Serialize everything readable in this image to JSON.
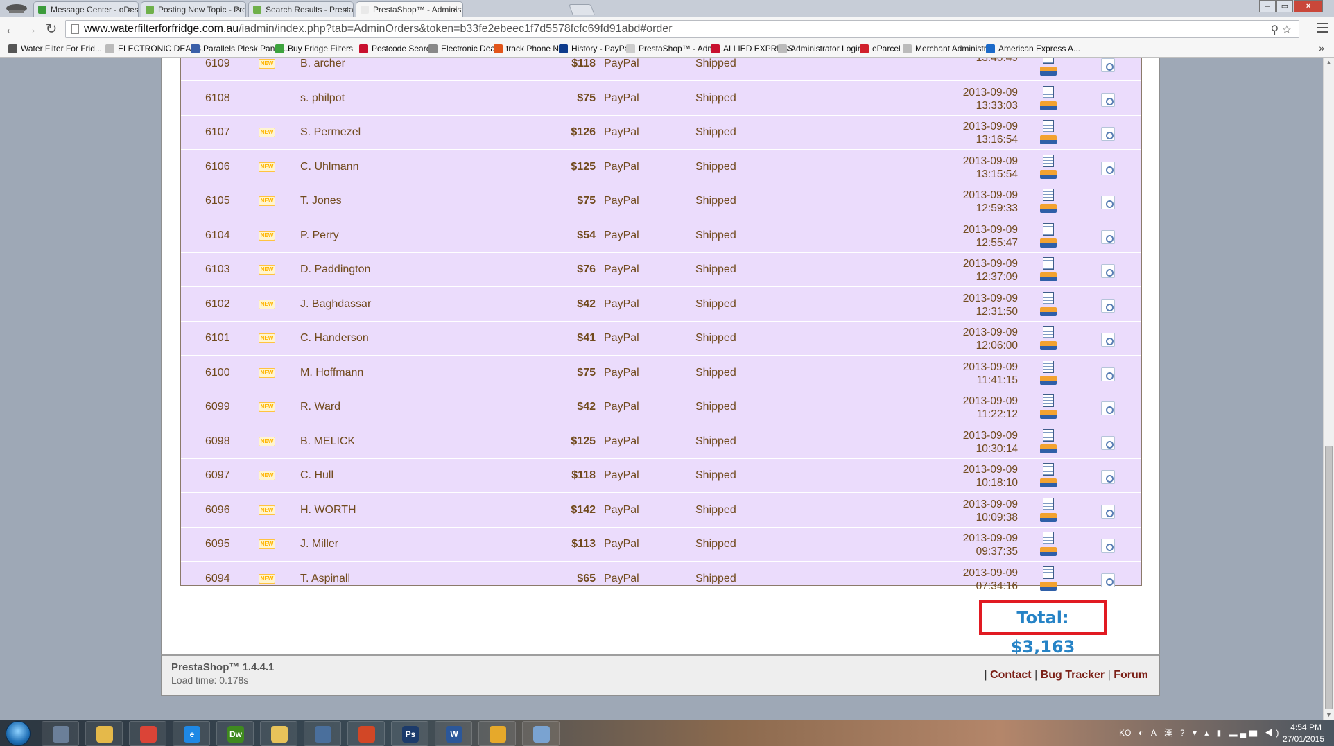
{
  "browser": {
    "tabs": [
      {
        "title": "Message Center - oDesk",
        "favicon_color": "#3c9c3c"
      },
      {
        "title": "Posting New Topic - Presta",
        "favicon_color": "#6fb04a"
      },
      {
        "title": "Search Results - PrestaSho",
        "favicon_color": "#6fb04a"
      },
      {
        "title": "PrestaShop™ - Administra",
        "favicon_color": "#e9e9e9"
      }
    ],
    "close_glyph": "×",
    "window_buttons": {
      "minimize": "–",
      "maximize": "▭",
      "close": "×"
    },
    "url_host": "www.waterfilterforfridge.com.au",
    "url_path": "/iadmin/index.php?tab=AdminOrders&token=b33fe2ebeec1f7d5578fcfc69fd91abd#order",
    "omni_right": "⚲ ☆"
  },
  "bookmarks": [
    {
      "label": "Water Filter For Frid...",
      "color": "#555555"
    },
    {
      "label": "ELECTRONIC DEALS...",
      "color": "#bbbbbb"
    },
    {
      "label": "Parallels Plesk Panel ...",
      "color": "#3a5fa8"
    },
    {
      "label": "Buy Fridge Filters",
      "color": "#3da33d"
    },
    {
      "label": "Postcode Search",
      "color": "#c8102e"
    },
    {
      "label": "Electronic Deals",
      "color": "#888888"
    },
    {
      "label": "track Phone No",
      "color": "#e2551a"
    },
    {
      "label": "History - PayPal",
      "color": "#0d3b8c"
    },
    {
      "label": "PrestaShop™ - Admi...",
      "color": "#cccccc"
    },
    {
      "label": "ALLIED EXPRESS",
      "color": "#c8102e"
    },
    {
      "label": "Administrator Login...",
      "color": "#bbbbbb"
    },
    {
      "label": "eParcel",
      "color": "#d01f2b"
    },
    {
      "label": "Merchant Administr...",
      "color": "#bbbbbb"
    },
    {
      "label": "American Express A...",
      "color": "#1b6ac9"
    }
  ],
  "bookmarks_more": "»",
  "orders": {
    "new_badge": "NEW",
    "rows": [
      {
        "id": "6109",
        "new": true,
        "customer": "B. archer",
        "amount": "$118",
        "payment": "PayPal",
        "status": "Shipped",
        "date": "",
        "time": "13:40:49"
      },
      {
        "id": "6108",
        "new": false,
        "customer": "s. philpot",
        "amount": "$75",
        "payment": "PayPal",
        "status": "Shipped",
        "date": "2013-09-09",
        "time": "13:33:03"
      },
      {
        "id": "6107",
        "new": true,
        "customer": "S. Permezel",
        "amount": "$126",
        "payment": "PayPal",
        "status": "Shipped",
        "date": "2013-09-09",
        "time": "13:16:54"
      },
      {
        "id": "6106",
        "new": true,
        "customer": "C. Uhlmann",
        "amount": "$125",
        "payment": "PayPal",
        "status": "Shipped",
        "date": "2013-09-09",
        "time": "13:15:54"
      },
      {
        "id": "6105",
        "new": true,
        "customer": "T. Jones",
        "amount": "$75",
        "payment": "PayPal",
        "status": "Shipped",
        "date": "2013-09-09",
        "time": "12:59:33"
      },
      {
        "id": "6104",
        "new": true,
        "customer": "P. Perry",
        "amount": "$54",
        "payment": "PayPal",
        "status": "Shipped",
        "date": "2013-09-09",
        "time": "12:55:47"
      },
      {
        "id": "6103",
        "new": true,
        "customer": "D. Paddington",
        "amount": "$76",
        "payment": "PayPal",
        "status": "Shipped",
        "date": "2013-09-09",
        "time": "12:37:09"
      },
      {
        "id": "6102",
        "new": true,
        "customer": "J. Baghdassar",
        "amount": "$42",
        "payment": "PayPal",
        "status": "Shipped",
        "date": "2013-09-09",
        "time": "12:31:50"
      },
      {
        "id": "6101",
        "new": true,
        "customer": "C. Handerson",
        "amount": "$41",
        "payment": "PayPal",
        "status": "Shipped",
        "date": "2013-09-09",
        "time": "12:06:00"
      },
      {
        "id": "6100",
        "new": true,
        "customer": "M. Hoffmann",
        "amount": "$75",
        "payment": "PayPal",
        "status": "Shipped",
        "date": "2013-09-09",
        "time": "11:41:15"
      },
      {
        "id": "6099",
        "new": true,
        "customer": "R. Ward",
        "amount": "$42",
        "payment": "PayPal",
        "status": "Shipped",
        "date": "2013-09-09",
        "time": "11:22:12"
      },
      {
        "id": "6098",
        "new": true,
        "customer": "B. MELICK",
        "amount": "$125",
        "payment": "PayPal",
        "status": "Shipped",
        "date": "2013-09-09",
        "time": "10:30:14"
      },
      {
        "id": "6097",
        "new": true,
        "customer": "C. Hull",
        "amount": "$118",
        "payment": "PayPal",
        "status": "Shipped",
        "date": "2013-09-09",
        "time": "10:18:10"
      },
      {
        "id": "6096",
        "new": true,
        "customer": "H. WORTH",
        "amount": "$142",
        "payment": "PayPal",
        "status": "Shipped",
        "date": "2013-09-09",
        "time": "10:09:38"
      },
      {
        "id": "6095",
        "new": true,
        "customer": "J. Miller",
        "amount": "$113",
        "payment": "PayPal",
        "status": "Shipped",
        "date": "2013-09-09",
        "time": "09:37:35"
      },
      {
        "id": "6094",
        "new": true,
        "customer": "T. Aspinall",
        "amount": "$65",
        "payment": "PayPal",
        "status": "Shipped",
        "date": "2013-09-09",
        "time": "07:34:16"
      }
    ],
    "total_label": "Total:",
    "total_value": "$3,163",
    "colors": {
      "row_bg": "#ebdcfc",
      "text": "#714a1d",
      "total": "#2683c6",
      "highlight": "#e11a22"
    }
  },
  "footer": {
    "version": "PrestaShop™ 1.4.4.1",
    "load_time": "Load time: 0.178s",
    "separator": "|",
    "links": [
      "Contact",
      "Bug Tracker",
      "Forum"
    ]
  },
  "taskbar": {
    "apps": [
      {
        "name": "calculator",
        "label": "",
        "color": "#6b7f99"
      },
      {
        "name": "explorer",
        "label": "",
        "color": "#e5b94a"
      },
      {
        "name": "chrome",
        "label": "",
        "color": "#db4437"
      },
      {
        "name": "internet-explorer",
        "label": "e",
        "color": "#1e88e5"
      },
      {
        "name": "dreamweaver",
        "label": "Dw",
        "color": "#3f8a1f"
      },
      {
        "name": "folder",
        "label": "",
        "color": "#e8c35a"
      },
      {
        "name": "remote-desktop",
        "label": "",
        "color": "#4a6f9c"
      },
      {
        "name": "office",
        "label": "",
        "color": "#d24726"
      },
      {
        "name": "photoshop",
        "label": "Ps",
        "color": "#1c3b6b"
      },
      {
        "name": "word",
        "label": "W",
        "color": "#2b579a"
      },
      {
        "name": "outlook",
        "label": "",
        "color": "#e6a92b"
      },
      {
        "name": "paint",
        "label": "",
        "color": "#7aa3d1"
      }
    ],
    "ime": "KO",
    "tray_icons": "◐ A 漢 ? ▾ ▴ ▮ ▂▄▆ ◀)",
    "time": "4:54 PM",
    "date": "27/01/2015"
  }
}
